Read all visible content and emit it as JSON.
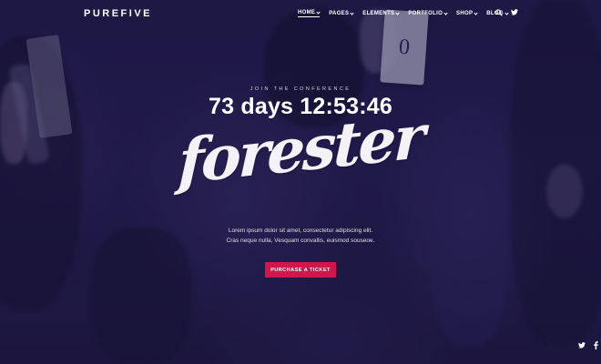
{
  "brand": {
    "logo_text": "PUREFIVE"
  },
  "nav": {
    "items": [
      {
        "label": "HOME",
        "active": true
      },
      {
        "label": "PAGES"
      },
      {
        "label": "ELEMENTS"
      },
      {
        "label": "PORTFOLIO"
      },
      {
        "label": "SHOP"
      },
      {
        "label": "BLOG"
      }
    ],
    "icons": [
      "search-icon",
      "twitter-icon"
    ]
  },
  "hero": {
    "eyebrow": "JOIN THE CONFERENCE",
    "countdown": "73 days 12:53:46",
    "title": "forester",
    "description_line1": "Lorem ipsum dolor sit amet, consectetur adipiscing elit.",
    "description_line2": "Cras neque nulla, Vesquam convallis, euismod souseoe.",
    "cta_label": "PURCHASE A TICKET",
    "badge_number": "0"
  },
  "social": {
    "icons": [
      "twitter-icon",
      "facebook-icon"
    ]
  },
  "colors": {
    "accent": "#d0174c",
    "overlay": "#1e1846",
    "text": "#ffffff"
  }
}
